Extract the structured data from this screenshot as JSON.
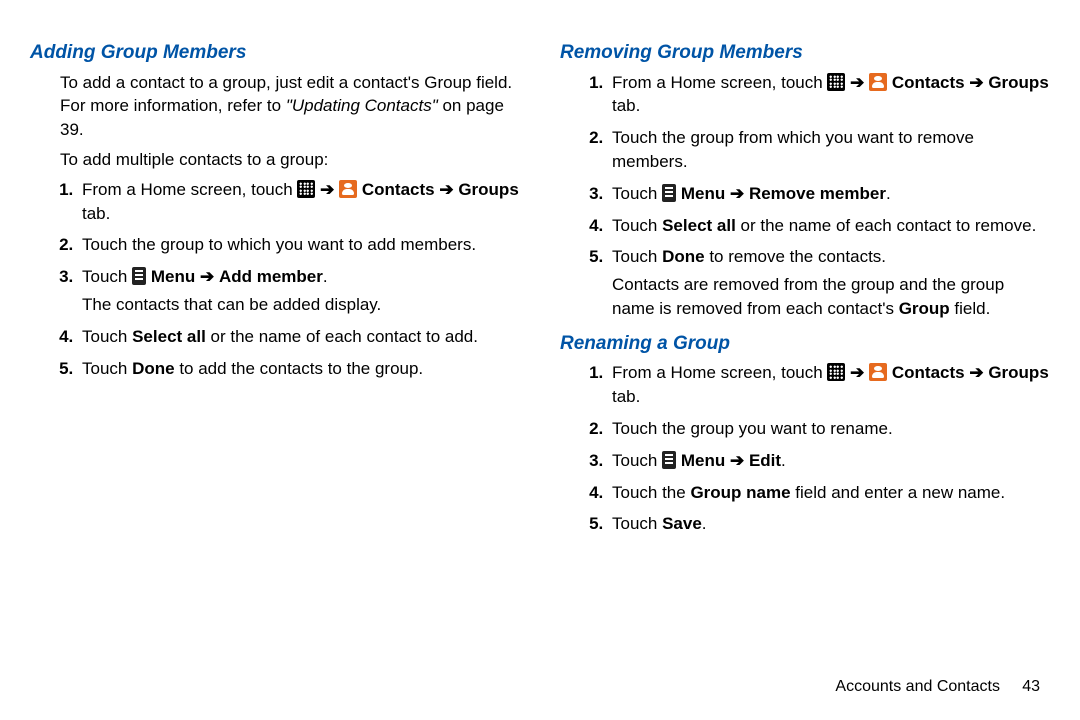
{
  "left": {
    "title": "Adding Group Members",
    "intro1a": "To add a contact to a group, just edit a contact's Group field. For more information, refer to ",
    "intro1_ref": "\"Updating Contacts\"",
    "intro1b": " on page 39.",
    "intro2": "To add multiple contacts to a group:",
    "s1a": "From a Home screen, touch ",
    "s1b": "Contacts",
    "s1c": "Groups",
    "s1d": " tab.",
    "s2": "Touch the group to which you want to add members.",
    "s3a": "Touch ",
    "s3b": "Menu",
    "s3c": "Add member",
    "s3_sub": "The contacts that can be added display.",
    "s4a": "Touch ",
    "s4b": "Select all",
    "s4c": " or the name of each contact to add.",
    "s5a": "Touch ",
    "s5b": "Done",
    "s5c": " to add the contacts to the group."
  },
  "right": {
    "remove": {
      "title": "Removing Group Members",
      "s1a": "From a Home screen, touch ",
      "s1b": "Contacts",
      "s1c": "Groups",
      "s1d": " tab.",
      "s2": "Touch the group from which you want to remove members.",
      "s3a": "Touch ",
      "s3b": "Menu",
      "s3c": "Remove member",
      "s4a": "Touch ",
      "s4b": "Select all",
      "s4c": " or the name of each contact to remove.",
      "s5a": "Touch ",
      "s5b": "Done",
      "s5c": " to remove the contacts.",
      "note1": "Contacts are removed from the group and the group name is removed from each contact's ",
      "note2": "Group",
      "note3": " field."
    },
    "rename": {
      "title": "Renaming a Group",
      "s1a": "From a Home screen, touch ",
      "s1b": "Contacts",
      "s1c": "Groups",
      "s1d": " tab.",
      "s2": "Touch the group you want to rename.",
      "s3a": "Touch ",
      "s3b": "Menu",
      "s3c": "Edit",
      "s4a": "Touch the ",
      "s4b": "Group name",
      "s4c": " field and enter a new name.",
      "s5a": "Touch ",
      "s5b": "Save",
      "s5c": "."
    }
  },
  "footer": {
    "label": "Accounts and Contacts",
    "page": "43"
  },
  "arrow": "➔"
}
